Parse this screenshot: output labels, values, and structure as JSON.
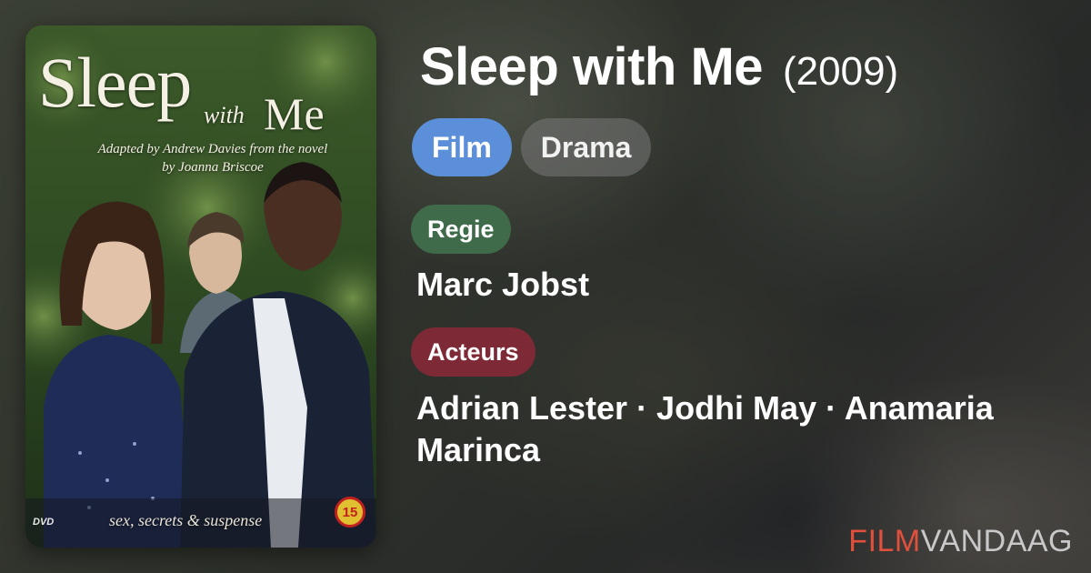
{
  "movie": {
    "title": "Sleep with Me",
    "year": "(2009)",
    "tags": [
      "Film",
      "Drama"
    ]
  },
  "poster": {
    "title_main": "Sleep",
    "title_with": "with",
    "title_me": "Me",
    "credit_line1": "Adapted by Andrew Davies from the novel",
    "credit_line2": "by Joanna Briscoe",
    "tagline": "sex, secrets & suspense",
    "rating": "15",
    "format": "DVD"
  },
  "director": {
    "label": "Regie",
    "value": "Marc Jobst"
  },
  "actors": {
    "label": "Acteurs",
    "value": "Adrian Lester · Jodhi May · Anamaria Marinca"
  },
  "brand": {
    "part1": "FILM",
    "part2": "VANDAAG"
  },
  "colors": {
    "film_tag": "#5b8fd9",
    "regie_label": "#3f6b4a",
    "acteurs_label": "#7e2a36",
    "brand_accent": "#e0503c"
  }
}
